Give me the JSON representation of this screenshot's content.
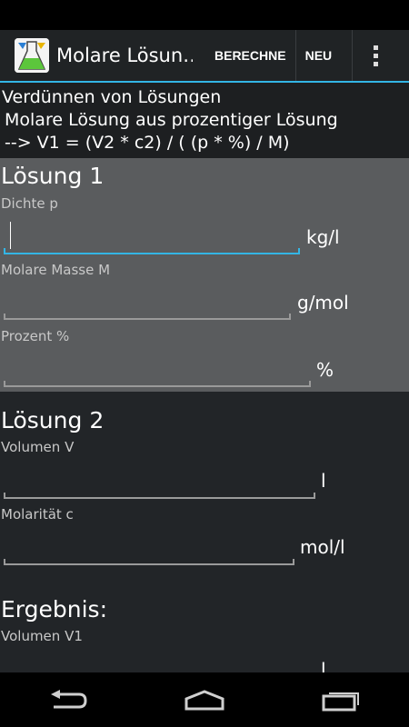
{
  "app": {
    "title": "Molare Lösun…",
    "actions": {
      "calculate": "BERECHNE",
      "new": "NEU"
    }
  },
  "header": {
    "line1": "Verdünnen von Lösungen",
    "line2": " Molare Lösung aus prozentiger Lösung",
    "line3": " --> V1 = (V2 * c2) / ( (p * %) / M)"
  },
  "solution1": {
    "title": "Lösung 1",
    "density": {
      "label": "Dichte p",
      "value": "",
      "unit": "kg/l"
    },
    "molar_mass": {
      "label": "Molare Masse M",
      "value": "",
      "unit": "g/mol"
    },
    "percent": {
      "label": "Prozent %",
      "value": "",
      "unit": "%"
    }
  },
  "solution2": {
    "title": "Lösung 2",
    "volume": {
      "label": "Volumen V",
      "value": "",
      "unit": "l"
    },
    "molarity": {
      "label": "Molarität c",
      "value": "",
      "unit": "mol/l"
    }
  },
  "result": {
    "title": "Ergebnis:",
    "volume1": {
      "label": "Volumen V1",
      "value": "",
      "unit": "l"
    }
  },
  "colors": {
    "accent": "#33b5e5",
    "panel1_bg": "#5a5c5e",
    "panel2_bg": "#222528"
  },
  "icons": {
    "app": "flask-icon",
    "overflow": "overflow-menu-icon",
    "back": "back-icon",
    "home": "home-icon",
    "recents": "recents-icon"
  }
}
